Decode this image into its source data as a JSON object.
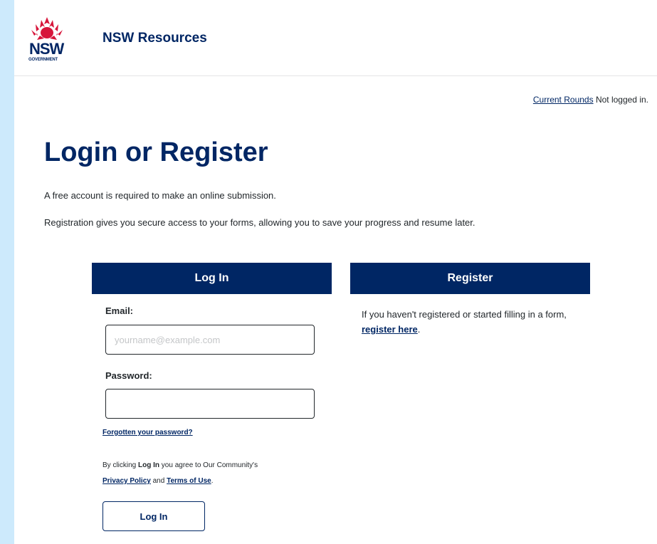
{
  "header": {
    "logo_text": "NSW",
    "logo_sub": "GOVERNMENT",
    "site_title": "NSW Resources"
  },
  "topbar": {
    "current_rounds": "Current Rounds",
    "status": "Not logged in."
  },
  "page": {
    "title": "Login or Register",
    "intro1": "A free account is required to make an online submission.",
    "intro2": "Registration gives you secure access to your forms, allowing you to save your progress and resume later."
  },
  "login": {
    "heading": "Log In",
    "email_label": "Email:",
    "email_placeholder": "yourname@example.com",
    "email_value": "",
    "password_label": "Password:",
    "password_value": "",
    "forgot": "Forgotten your password?",
    "agree_prefix": "By clicking ",
    "agree_bold": "Log In",
    "agree_mid": " you agree to Our Community's",
    "privacy": "Privacy Policy",
    "and": " and ",
    "terms": "Terms of Use",
    "period": ".",
    "button": "Log In"
  },
  "register": {
    "heading": "Register",
    "text": "If you haven't registered or started filling in a form, ",
    "link": "register here",
    "period": "."
  },
  "colors": {
    "brand_navy": "#002664",
    "brand_red": "#d7153a",
    "outer_bg": "#cdeafc"
  }
}
